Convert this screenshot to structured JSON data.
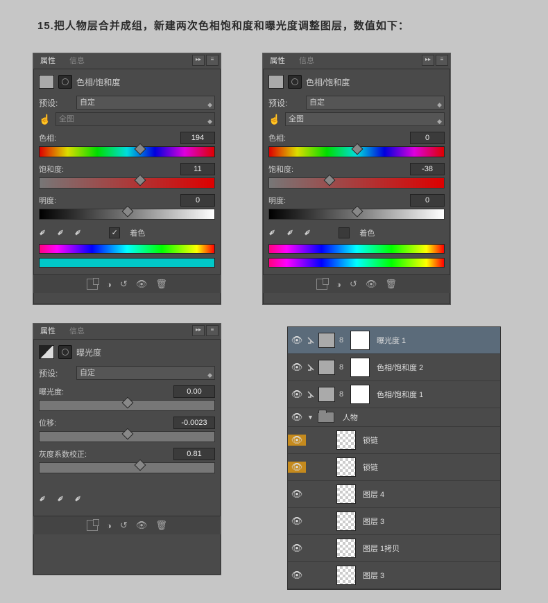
{
  "page_title": "15.把人物层合并成组，新建两次色相饱和度和曝光度调整图层，数值如下：",
  "tabs": {
    "properties": "属性",
    "info": "信息"
  },
  "hs": {
    "title": "色相/饱和度",
    "preset_label": "预设:",
    "preset_value": "自定",
    "range_value": "全图",
    "hue_label": "色相:",
    "sat_label": "饱和度:",
    "light_label": "明度:",
    "colorize_label": "着色"
  },
  "panel1": {
    "hue": "194",
    "sat": "11",
    "light": "0",
    "colorize_checked": true
  },
  "panel2": {
    "hue": "0",
    "sat": "-38",
    "light": "0",
    "colorize_checked": false
  },
  "exp": {
    "title": "曝光度",
    "preset_label": "预设:",
    "preset_value": "自定",
    "exposure_label": "曝光度:",
    "exposure_value": "0.00",
    "offset_label": "位移:",
    "offset_value": "-0.0023",
    "gamma_label": "灰度系数校正:",
    "gamma_value": "0.81"
  },
  "layers": [
    {
      "name": "曝光度 1",
      "type": "adj",
      "mask": true,
      "selected": true,
      "indent": 1
    },
    {
      "name": "色相/饱和度 2",
      "type": "adj",
      "mask": true,
      "indent": 1
    },
    {
      "name": "色相/饱和度 1",
      "type": "adj",
      "mask": true,
      "indent": 1
    },
    {
      "name": "人物",
      "type": "folder",
      "open": true,
      "indent": 0
    },
    {
      "name": "锁链",
      "type": "layer",
      "color": "#c58a1d",
      "indent": 1
    },
    {
      "name": "锁链",
      "type": "layer",
      "color": "#c58a1d",
      "indent": 1
    },
    {
      "name": "图层 4",
      "type": "layer",
      "indent": 1
    },
    {
      "name": "图层 3",
      "type": "layer",
      "indent": 1
    },
    {
      "name": "图层 1拷贝",
      "type": "layer",
      "indent": 1
    },
    {
      "name": "图层 3",
      "type": "layer",
      "indent": 1
    }
  ]
}
